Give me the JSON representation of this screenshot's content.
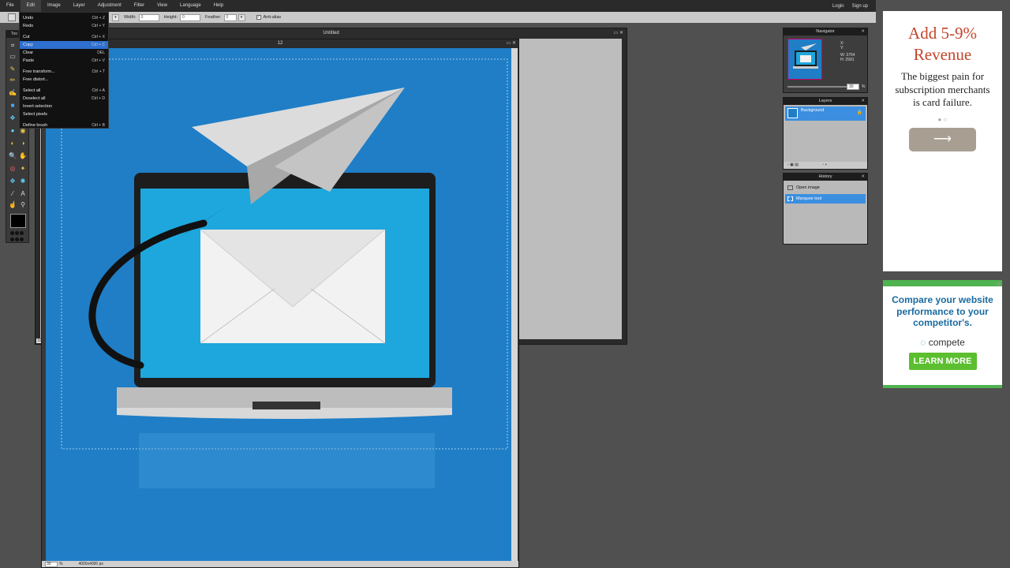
{
  "menubar": {
    "items": [
      "File",
      "Edit",
      "Image",
      "Layer",
      "Adjustment",
      "Filter",
      "View",
      "Language",
      "Help"
    ],
    "login": "Login",
    "signup": "Sign up"
  },
  "options": {
    "width_label": "Width:",
    "width_value": "0",
    "height_label": "Height:",
    "height_value": "0",
    "feather_label": "Feather:",
    "feather_value": "0",
    "antialias_label": "Anti-alias",
    "antialias_checked": true
  },
  "edit_menu": {
    "items": [
      {
        "label": "Undo",
        "shortcut": "Ctrl + Z"
      },
      {
        "label": "Redo",
        "shortcut": "Ctrl + Y"
      },
      {
        "label": "Cut",
        "shortcut": "Ctrl + X"
      },
      {
        "label": "Copy",
        "shortcut": "Ctrl + C"
      },
      {
        "label": "Clear",
        "shortcut": "DEL"
      },
      {
        "label": "Paste",
        "shortcut": "Ctrl + V"
      },
      {
        "label": "Free transform...",
        "shortcut": "Ctrl + T"
      },
      {
        "label": "Free distort...",
        "shortcut": ""
      },
      {
        "label": "Select all",
        "shortcut": "Ctrl + A"
      },
      {
        "label": "Deselect all",
        "shortcut": "Ctrl + D"
      },
      {
        "label": "Invert selection",
        "shortcut": ""
      },
      {
        "label": "Select pixels",
        "shortcut": ""
      },
      {
        "label": "Define brush",
        "shortcut": "Ctrl + B"
      }
    ],
    "highlighted_index": 3
  },
  "tools_panel": {
    "title": "Too"
  },
  "documents": {
    "background": {
      "title": "Untitled",
      "zoom_label": "100"
    },
    "front": {
      "title": "12",
      "zoom": "30",
      "zoom_unit": "%",
      "dimensions": "4000x4000 px"
    }
  },
  "navigator": {
    "title": "Navigator",
    "x_label": "X:",
    "y_label": "Y:",
    "w_label": "W: 3764",
    "h_label": "H: 2991",
    "zoom": "30",
    "zoom_unit": "%"
  },
  "layers": {
    "title": "Layers",
    "items": [
      {
        "name": "Background",
        "locked": true
      }
    ]
  },
  "history": {
    "title": "History",
    "items": [
      {
        "label": "Open image",
        "selected": false
      },
      {
        "label": "Marquee tool",
        "selected": true
      }
    ]
  },
  "ad1": {
    "headline": "Add 5-9% Revenue",
    "body": "The biggest pain for subscription merchants is card failure.",
    "cta_icon": "arrow-right-icon"
  },
  "ad2": {
    "headline": "Compare your website performance to your competitor's.",
    "brand": "compete",
    "button": "LEARN MORE"
  },
  "colors": {
    "canvas_blue": "#1f7ec6",
    "selection_blue": "#3c8fe0",
    "ad_red": "#c4442a",
    "ad_green": "#5bbf2f"
  }
}
